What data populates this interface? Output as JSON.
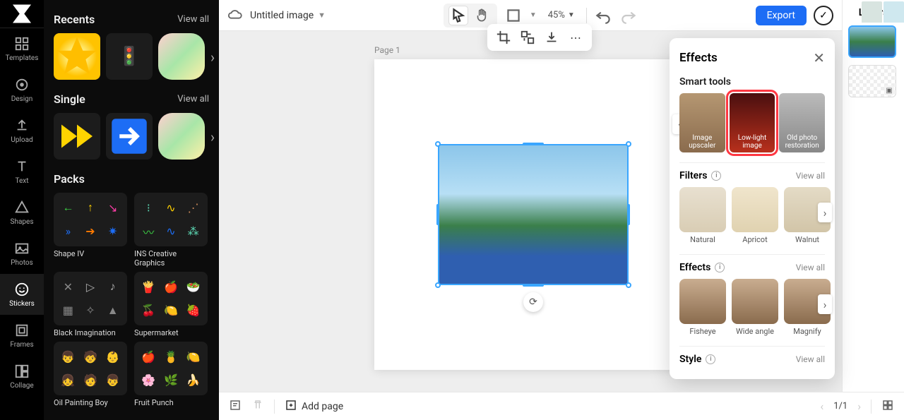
{
  "leftRail": {
    "items": [
      {
        "label": "Templates"
      },
      {
        "label": "Design"
      },
      {
        "label": "Upload"
      },
      {
        "label": "Text"
      },
      {
        "label": "Shapes"
      },
      {
        "label": "Photos"
      },
      {
        "label": "Stickers"
      },
      {
        "label": "Frames"
      },
      {
        "label": "Collage"
      }
    ]
  },
  "sidePanel": {
    "recents": {
      "title": "Recents",
      "viewAll": "View all"
    },
    "single": {
      "title": "Single",
      "viewAll": "View all"
    },
    "packs": {
      "title": "Packs",
      "items": [
        {
          "label": "Shape IV"
        },
        {
          "label": "INS Creative Graphics"
        },
        {
          "label": "Black Imagination"
        },
        {
          "label": "Supermarket"
        },
        {
          "label": "Oil Painting Boy"
        },
        {
          "label": "Fruit Punch"
        }
      ]
    }
  },
  "topbar": {
    "title": "Untitled image",
    "zoom": "45%",
    "export": "Export"
  },
  "canvas": {
    "pageLabel": "Page 1"
  },
  "layersPanel": {
    "title": "Layers"
  },
  "effects": {
    "title": "Effects",
    "smartTools": {
      "title": "Smart tools",
      "items": [
        {
          "label": "Image upscaler"
        },
        {
          "label": "Low-light image"
        },
        {
          "label": "Old photo restoration"
        }
      ]
    },
    "filters": {
      "title": "Filters",
      "viewAll": "View all",
      "items": [
        {
          "label": "Natural"
        },
        {
          "label": "Apricot"
        },
        {
          "label": "Walnut"
        }
      ]
    },
    "effectsRow": {
      "title": "Effects",
      "viewAll": "View all",
      "items": [
        {
          "label": "Fisheye"
        },
        {
          "label": "Wide angle"
        },
        {
          "label": "Magnify"
        }
      ]
    },
    "style": {
      "title": "Style",
      "viewAll": "View all"
    }
  },
  "bottombar": {
    "addPage": "Add page",
    "pageIndicator": "1/1"
  }
}
